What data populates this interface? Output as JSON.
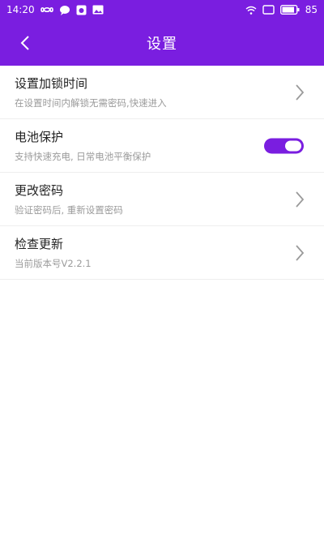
{
  "status_bar": {
    "time": "14:20",
    "battery": "85",
    "icons_left": [
      "infinity-icon",
      "message-bubble-icon",
      "photo-app-icon",
      "image-icon"
    ],
    "icons_right": [
      "wifi-icon",
      "screen-icon",
      "battery-icon"
    ]
  },
  "header": {
    "title": "设置",
    "back_icon": "back-arrow-icon",
    "color": "#7a1ee0"
  },
  "settings": [
    {
      "title": "设置加锁时间",
      "subtitle": "在设置时间内解锁无需密码,快速进入",
      "control": "chevron"
    },
    {
      "title": "电池保护",
      "subtitle": "支持快速充电, 日常电池平衡保护",
      "control": "toggle",
      "enabled": true
    },
    {
      "title": "更改密码",
      "subtitle": "验证密码后, 重新设置密码",
      "control": "chevron"
    },
    {
      "title": "检查更新",
      "subtitle": "当前版本号V2.2.1",
      "control": "chevron"
    }
  ]
}
